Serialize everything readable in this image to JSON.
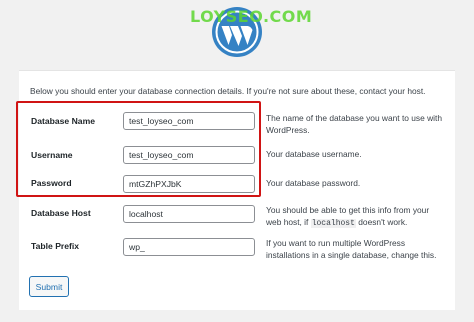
{
  "header": {
    "logo_icon": "wordpress-logo-icon",
    "watermark_text": "LOYSEO.COM",
    "watermark_color": "#5cd630",
    "logo_color": "#3582c4"
  },
  "form": {
    "intro_text": "Below you should enter your database connection details. If you're not sure about these, contact your host.",
    "fields": [
      {
        "label": "Database Name",
        "value": "test_loyseo_com",
        "description": "The name of the database you want to use with WordPress."
      },
      {
        "label": "Username",
        "value": "test_loyseo_com",
        "description": "Your database username."
      },
      {
        "label": "Password",
        "value": "mtGZhPXJbK",
        "description": "Your database password."
      },
      {
        "label": "Database Host",
        "value": "localhost",
        "description_parts": [
          "You should be able to get this info from your web host, if",
          "localhost",
          "doesn't work."
        ]
      },
      {
        "label": "Table Prefix",
        "value": "wp_",
        "description": "If you want to run multiple WordPress installations in a single database, change this."
      }
    ],
    "submit_label": "Submit"
  },
  "colors": {
    "highlight_border": "#d01414",
    "button_accent": "#2271b1"
  }
}
